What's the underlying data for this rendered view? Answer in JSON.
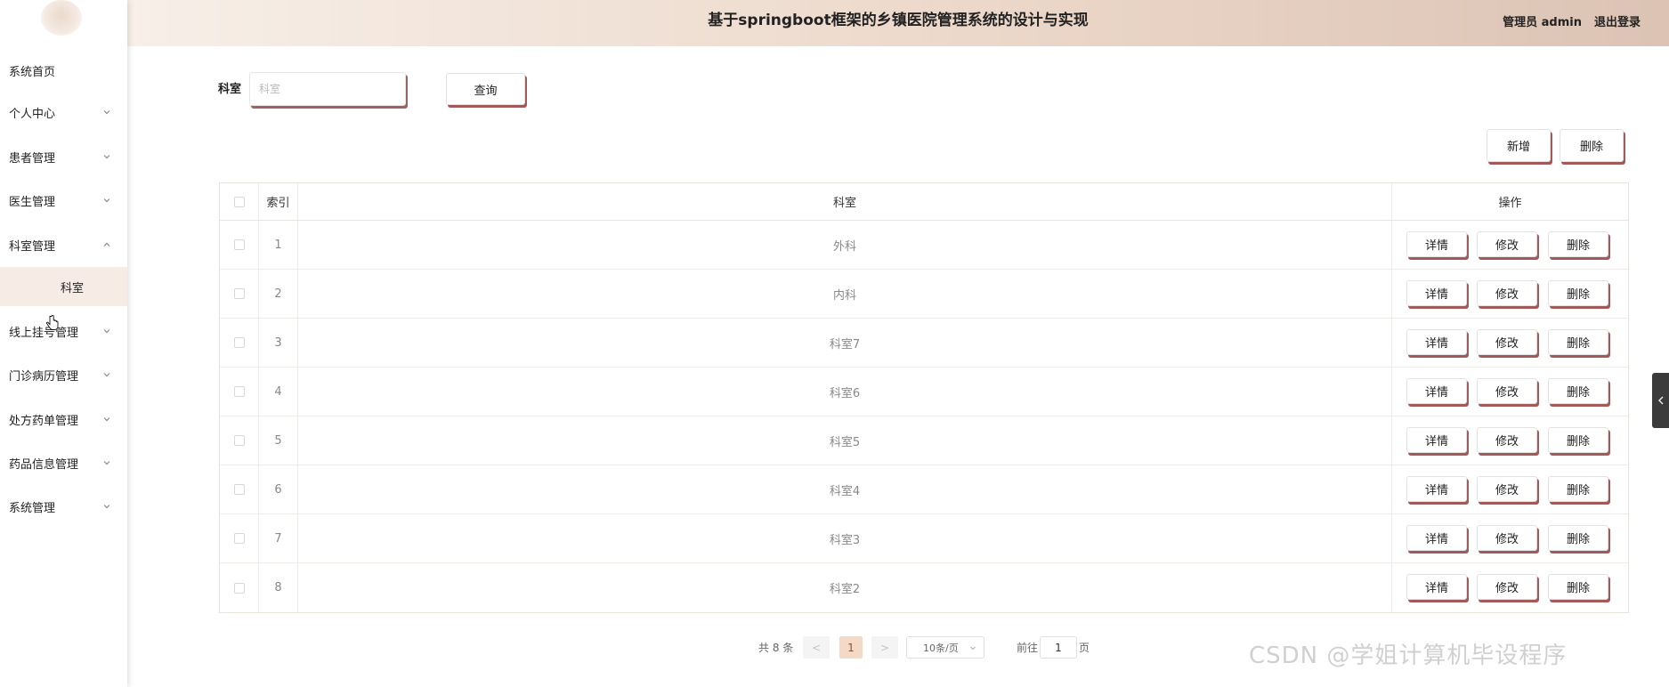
{
  "header": {
    "title": "基于springboot框架的乡镇医院管理系统的设计与实现",
    "user": "管理员 admin",
    "logout": "退出登录"
  },
  "sidebar": {
    "items": [
      {
        "label": "系统首页"
      },
      {
        "label": "个人中心"
      },
      {
        "label": "患者管理"
      },
      {
        "label": "医生管理"
      },
      {
        "label": "科室管理"
      },
      {
        "label": "线上挂号管理"
      },
      {
        "label": "门诊病历管理"
      },
      {
        "label": "处方药单管理"
      },
      {
        "label": "药品信息管理"
      },
      {
        "label": "系统管理"
      }
    ],
    "submenu": {
      "label": "科室"
    }
  },
  "search": {
    "label": "科室",
    "placeholder": "科室",
    "query_label": "查询"
  },
  "toolbar": {
    "add_label": "新增",
    "delete_label": "删除"
  },
  "table": {
    "headers": {
      "index": "索引",
      "name": "科室",
      "ops": "操作"
    },
    "rows": [
      {
        "index": "1",
        "name": "外科"
      },
      {
        "index": "2",
        "name": "内科"
      },
      {
        "index": "3",
        "name": "科室7"
      },
      {
        "index": "4",
        "name": "科室6"
      },
      {
        "index": "5",
        "name": "科室5"
      },
      {
        "index": "6",
        "name": "科室4"
      },
      {
        "index": "7",
        "name": "科室3"
      },
      {
        "index": "8",
        "name": "科室2"
      }
    ],
    "ops": {
      "detail": "详情",
      "edit": "修改",
      "delete": "删除"
    }
  },
  "pagination": {
    "total": "共 8 条",
    "prev": "<",
    "page": "1",
    "next": ">",
    "size": "10条/页",
    "goto": "前往",
    "jump_value": "1",
    "unit": "页"
  },
  "watermark": "CSDN @学姐计算机毕设程序",
  "colors": {
    "accent_shadow": "#a05a5a",
    "active_page": "#f3d9c6",
    "submenu_bg": "#f6ece5",
    "header_start": "#f7efe8",
    "header_end": "#dcc3b4"
  }
}
